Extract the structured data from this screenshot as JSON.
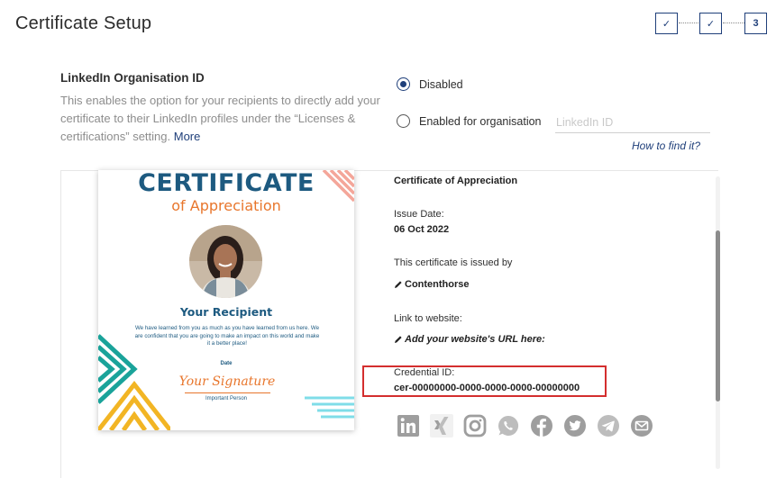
{
  "header": {
    "title": "Certificate Setup",
    "steps": [
      {
        "label": "✓",
        "state": "done"
      },
      {
        "label": "✓",
        "state": "done"
      },
      {
        "label": "3",
        "state": "current"
      }
    ]
  },
  "linkedin": {
    "title": "LinkedIn Organisation ID",
    "description": "This enables the option for your recipients to directly add your certificate to their LinkedIn profiles under the “Licenses & certifications” setting.",
    "more_label": "More",
    "options": [
      {
        "label": "Disabled",
        "selected": true
      },
      {
        "label": "Enabled for organisation",
        "selected": false
      }
    ],
    "input_placeholder": "LinkedIn ID",
    "input_value": "",
    "help_link": "How to find it?"
  },
  "certificate": {
    "title": "CERTIFICATE",
    "subtitle": "of Appreciation",
    "recipient": "Your Recipient",
    "body": "We have learned from you as much as you have learned from us here. We are confident that you are going to make an impact on this world and make it a better place!",
    "date_label": "Date",
    "signature": "Your Signature",
    "signer": "Important Person"
  },
  "details": {
    "cert_name": "Certificate of Appreciation",
    "issue_date_label": "Issue Date:",
    "issue_date": "06 Oct 2022",
    "issued_by_label": "This certificate is issued by",
    "issuer": "Contenthorse",
    "website_label": "Link to website:",
    "website_prompt": "Add your website's URL here:",
    "credential_label": "Credential ID:",
    "credential_id": "cer-00000000-0000-0000-0000-00000000"
  },
  "share_icons": [
    "linkedin-icon",
    "xing-icon",
    "instagram-icon",
    "whatsapp-icon",
    "facebook-icon",
    "twitter-icon",
    "telegram-icon",
    "email-icon"
  ],
  "colors": {
    "brand_navy": "#1f3f7a",
    "cert_blue": "#1d5a80",
    "cert_orange": "#e8762c",
    "highlight_red": "#d42e2e",
    "icon_gray": "#9e9e9e"
  }
}
